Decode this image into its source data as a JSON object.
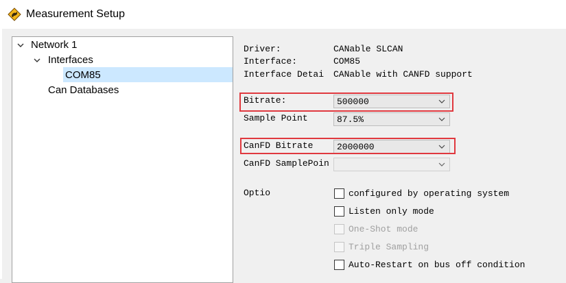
{
  "window": {
    "title": "Measurement Setup",
    "icon": "kangaroo-icon"
  },
  "tree": {
    "items": [
      {
        "label": "Network 1",
        "expanded": true
      },
      {
        "label": "Interfaces",
        "expanded": true
      },
      {
        "label": "COM85",
        "selected": true
      },
      {
        "label": "Can Databases"
      }
    ]
  },
  "details": {
    "driver_label": "Driver:",
    "driver_value": "CANable SLCAN",
    "interface_label": "Interface:",
    "interface_value": "COM85",
    "interface_detail_label": "Interface Detai",
    "interface_detail_value": "CANable with CANFD support"
  },
  "settings": {
    "bitrate_label": "Bitrate:",
    "bitrate_value": "500000",
    "sample_point_label": "Sample Point",
    "sample_point_value": "87.5%",
    "canfd_bitrate_label": "CanFD Bitrate",
    "canfd_bitrate_value": "2000000",
    "canfd_samplepoint_label": "CanFD SamplePoin",
    "canfd_samplepoint_value": ""
  },
  "options": {
    "label": "Optio",
    "items": [
      {
        "label": "configured by operating system",
        "checked": false,
        "enabled": true
      },
      {
        "label": "Listen only mode",
        "checked": false,
        "enabled": true
      },
      {
        "label": "One-Shot mode",
        "checked": false,
        "enabled": false
      },
      {
        "label": "Triple Sampling",
        "checked": false,
        "enabled": false
      },
      {
        "label": "Auto-Restart on bus off condition",
        "checked": false,
        "enabled": true
      }
    ]
  },
  "colors": {
    "highlight": "#e0383e",
    "selection": "#cce8ff"
  }
}
